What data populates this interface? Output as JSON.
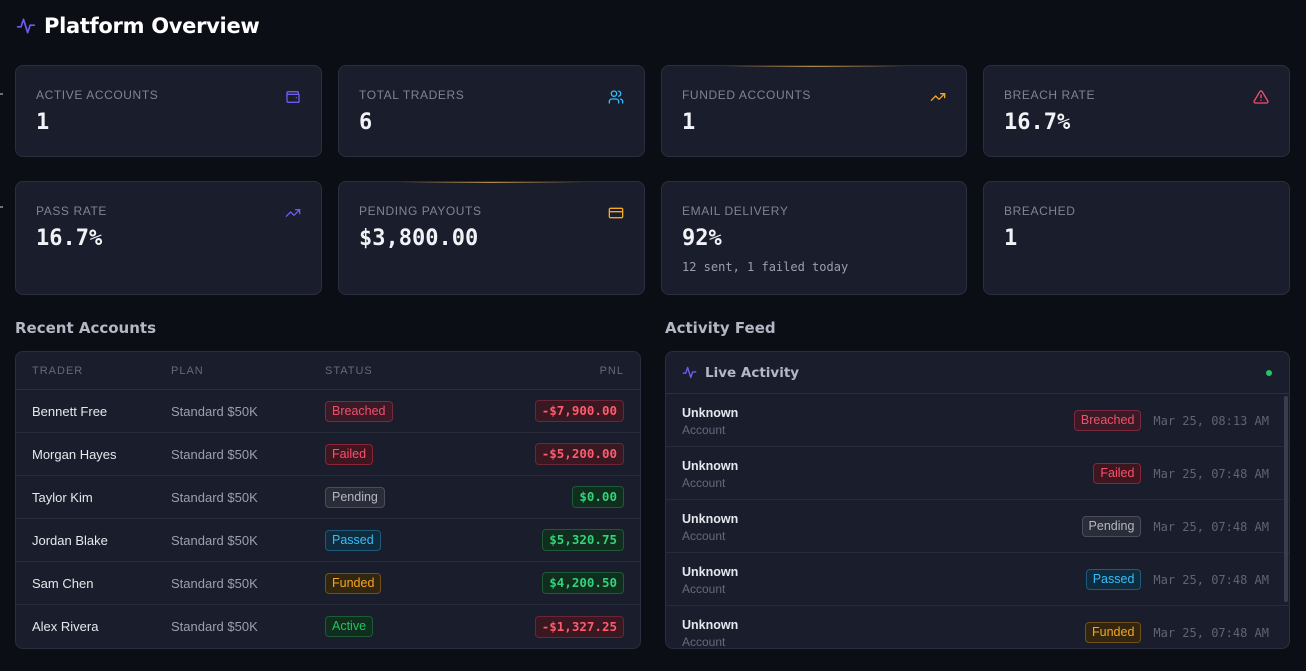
{
  "page": {
    "title": "Platform Overview"
  },
  "stats": [
    {
      "label": "ACTIVE ACCOUNTS",
      "value": "1",
      "icon": "wallet-icon",
      "icon_color": "#6d5cf0"
    },
    {
      "label": "TOTAL TRADERS",
      "value": "6",
      "icon": "users-icon",
      "icon_color": "#38bdf8"
    },
    {
      "label": "FUNDED ACCOUNTS",
      "value": "1",
      "icon": "trending-up-icon",
      "icon_color": "#f5a623"
    },
    {
      "label": "BREACH RATE",
      "value": "16.7%",
      "icon": "alert-triangle-icon",
      "icon_color": "#f0506e"
    },
    {
      "label": "PASS RATE",
      "value": "16.7%",
      "icon": "trending-up-icon",
      "icon_color": "#6d5cf0"
    },
    {
      "label": "PENDING PAYOUTS",
      "value": "$3,800.00",
      "icon": "credit-card-icon",
      "icon_color": "#f5a623"
    },
    {
      "label": "EMAIL DELIVERY",
      "value": "92%",
      "sub": "12 sent, 1 failed today"
    },
    {
      "label": "BREACHED",
      "value": "1"
    }
  ],
  "recent_accounts": {
    "title": "Recent Accounts",
    "columns": [
      "TRADER",
      "PLAN",
      "STATUS",
      "PNL"
    ],
    "rows": [
      {
        "trader": "Bennett Free",
        "plan": "Standard $50K",
        "status": "Breached",
        "pnl": "-$7,900.00"
      },
      {
        "trader": "Morgan Hayes",
        "plan": "Standard $50K",
        "status": "Failed",
        "pnl": "-$5,200.00"
      },
      {
        "trader": "Taylor Kim",
        "plan": "Standard $50K",
        "status": "Pending",
        "pnl": "$0.00"
      },
      {
        "trader": "Jordan Blake",
        "plan": "Standard $50K",
        "status": "Passed",
        "pnl": "$5,320.75"
      },
      {
        "trader": "Sam Chen",
        "plan": "Standard $50K",
        "status": "Funded",
        "pnl": "$4,200.50"
      },
      {
        "trader": "Alex Rivera",
        "plan": "Standard $50K",
        "status": "Active",
        "pnl": "-$1,327.25"
      }
    ]
  },
  "activity": {
    "section_title": "Activity Feed",
    "title": "Live Activity",
    "items": [
      {
        "name": "Unknown",
        "type": "Account",
        "status": "Breached",
        "time": "Mar 25, 08:13 AM"
      },
      {
        "name": "Unknown",
        "type": "Account",
        "status": "Failed",
        "time": "Mar 25, 07:48 AM"
      },
      {
        "name": "Unknown",
        "type": "Account",
        "status": "Pending",
        "time": "Mar 25, 07:48 AM"
      },
      {
        "name": "Unknown",
        "type": "Account",
        "status": "Passed",
        "time": "Mar 25, 07:48 AM"
      },
      {
        "name": "Unknown",
        "type": "Account",
        "status": "Funded",
        "time": "Mar 25, 07:48 AM"
      }
    ]
  }
}
